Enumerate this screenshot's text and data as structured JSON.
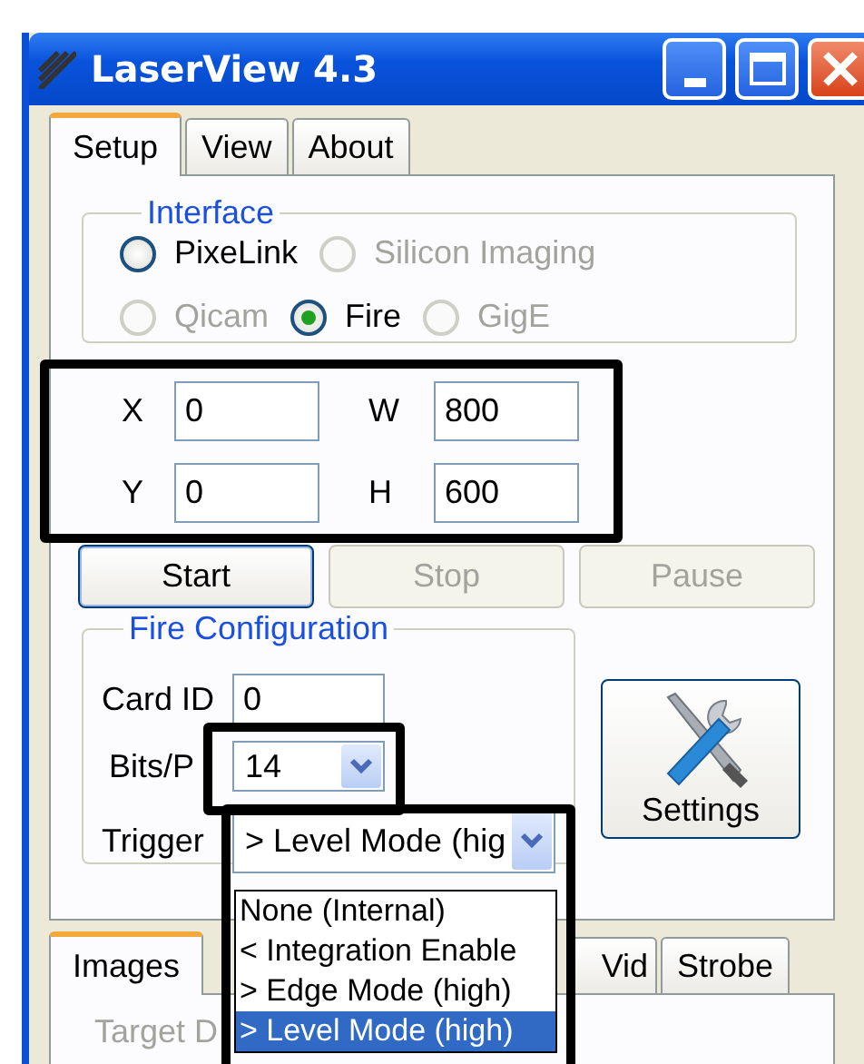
{
  "window": {
    "title": "LaserView 4.3"
  },
  "tabs": [
    {
      "label": "Setup",
      "selected": true
    },
    {
      "label": "View",
      "selected": false
    },
    {
      "label": "About",
      "selected": false
    }
  ],
  "interface": {
    "title": "Interface",
    "rows": [
      [
        {
          "label": "PixeLink",
          "selected": false,
          "disabled": false
        },
        {
          "label": "Silicon Imaging",
          "selected": false,
          "disabled": true
        }
      ],
      [
        {
          "label": "Qicam",
          "selected": false,
          "disabled": true
        },
        {
          "label": "Fire",
          "selected": true,
          "disabled": false
        },
        {
          "label": "GigE",
          "selected": false,
          "disabled": true
        }
      ]
    ]
  },
  "region": {
    "rows": [
      [
        {
          "label": "X",
          "value": "0"
        },
        {
          "label": "W",
          "value": "800"
        }
      ],
      [
        {
          "label": "Y",
          "value": "0"
        },
        {
          "label": "H",
          "value": "600"
        }
      ]
    ]
  },
  "buttons": [
    {
      "label": "Start",
      "disabled": false
    },
    {
      "label": "Stop",
      "disabled": true
    },
    {
      "label": "Pause",
      "disabled": true
    }
  ],
  "fire_config": {
    "title": "Fire Configuration",
    "card_id": {
      "label": "Card ID",
      "value": "0"
    },
    "bits": {
      "label": "Bits/P",
      "value": "14"
    },
    "trigger": {
      "label": "Trigger",
      "value": "> Level Mode (hig",
      "options": [
        {
          "label": "None (Internal)",
          "selected": false
        },
        {
          "label": "< Integration Enable",
          "selected": false
        },
        {
          "label": "> Edge Mode (high)",
          "selected": false
        },
        {
          "label": "> Level Mode (high)",
          "selected": true
        }
      ]
    }
  },
  "settings_button": {
    "label": "Settings"
  },
  "lower_tabs": [
    {
      "label": "Images",
      "selected": true
    },
    {
      "label": "Vid",
      "selected": false
    },
    {
      "label": "Strobe",
      "selected": false
    }
  ],
  "lower_panel": {
    "label": "Target D",
    "disabled": true
  }
}
